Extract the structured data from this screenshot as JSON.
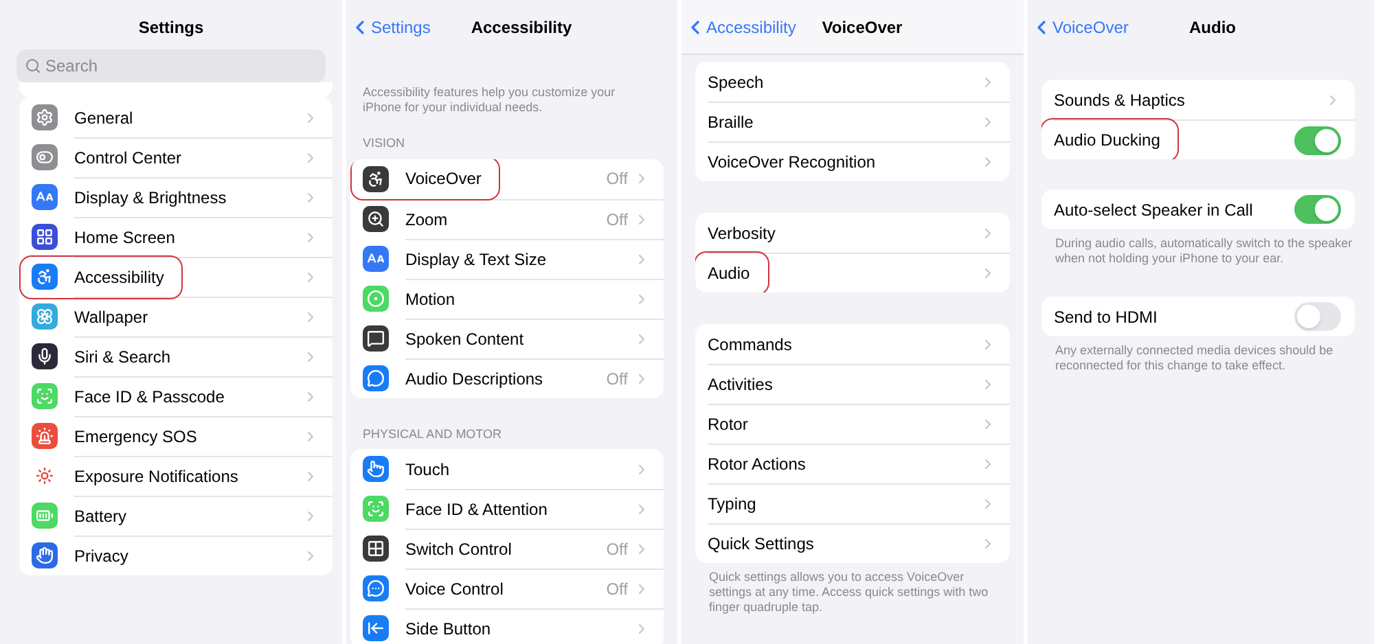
{
  "panels": [
    {
      "title": "Settings",
      "search": {
        "placeholder": "Search"
      },
      "groups": [
        {
          "items": [
            {
              "label": "General",
              "kind": "link",
              "color": "#8e8e93",
              "circled": false
            },
            {
              "label": "Control Center",
              "kind": "link",
              "color": "#8e8e93",
              "circled": false
            },
            {
              "label": "Display & Brightness",
              "kind": "link",
              "color": "#3478f6",
              "circled": false
            },
            {
              "label": "Home Screen",
              "kind": "link",
              "color": "#3a4fd6",
              "circled": false
            },
            {
              "label": "Accessibility",
              "kind": "link",
              "color": "#1a7cf5",
              "circled": true
            },
            {
              "label": "Wallpaper",
              "kind": "link",
              "color": "#35aadc",
              "circled": false
            },
            {
              "label": "Siri & Search",
              "kind": "link",
              "color": "#2a2a3a",
              "circled": false
            },
            {
              "label": "Face ID & Passcode",
              "kind": "link",
              "color": "#4cd964",
              "circled": false
            },
            {
              "label": "Emergency SOS",
              "kind": "link",
              "color": "#ea4e3d",
              "circled": false
            },
            {
              "label": "Exposure Notifications",
              "kind": "link",
              "color": "#ffffff",
              "circled": false
            },
            {
              "label": "Battery",
              "kind": "link",
              "color": "#4cd964",
              "circled": false
            },
            {
              "label": "Privacy",
              "kind": "link",
              "color": "#2c6ae6",
              "circled": false
            }
          ]
        }
      ]
    },
    {
      "back": "Settings",
      "title": "Accessibility",
      "intro": "Accessibility features help you customize your iPhone for your individual needs.",
      "groups": [
        {
          "header": "VISION",
          "items": [
            {
              "label": "VoiceOver",
              "kind": "link",
              "value": "Off",
              "color": "#3a3a3c",
              "circled": true
            },
            {
              "label": "Zoom",
              "kind": "link",
              "value": "Off",
              "color": "#3a3a3c",
              "circled": false
            },
            {
              "label": "Display & Text Size",
              "kind": "link",
              "color": "#3478f6",
              "circled": false
            },
            {
              "label": "Motion",
              "kind": "link",
              "color": "#4cd964",
              "circled": false
            },
            {
              "label": "Spoken Content",
              "kind": "link",
              "color": "#3a3a3c",
              "circled": false
            },
            {
              "label": "Audio Descriptions",
              "kind": "link",
              "value": "Off",
              "color": "#1a7cf5",
              "circled": false
            }
          ]
        },
        {
          "header": "PHYSICAL AND MOTOR",
          "items": [
            {
              "label": "Touch",
              "kind": "link",
              "color": "#1a7cf5",
              "circled": false
            },
            {
              "label": "Face ID & Attention",
              "kind": "link",
              "color": "#4cd964",
              "circled": false
            },
            {
              "label": "Switch Control",
              "kind": "link",
              "value": "Off",
              "color": "#3a3a3c",
              "circled": false
            },
            {
              "label": "Voice Control",
              "kind": "link",
              "value": "Off",
              "color": "#1a7cf5",
              "circled": false
            },
            {
              "label": "Side Button",
              "kind": "link",
              "color": "#1a7cf5",
              "circled": false
            }
          ]
        }
      ]
    },
    {
      "back": "Accessibility",
      "title": "VoiceOver",
      "groups": [
        {
          "items": [
            {
              "label": "Speech",
              "kind": "link",
              "circled": false
            },
            {
              "label": "Braille",
              "kind": "link",
              "circled": false
            },
            {
              "label": "VoiceOver Recognition",
              "kind": "link",
              "circled": false
            }
          ]
        },
        {
          "items": [
            {
              "label": "Verbosity",
              "kind": "link",
              "circled": false
            },
            {
              "label": "Audio",
              "kind": "link",
              "circled": true
            }
          ]
        },
        {
          "items": [
            {
              "label": "Commands",
              "kind": "link",
              "circled": false
            },
            {
              "label": "Activities",
              "kind": "link",
              "circled": false
            },
            {
              "label": "Rotor",
              "kind": "link",
              "circled": false
            },
            {
              "label": "Rotor Actions",
              "kind": "link",
              "circled": false
            },
            {
              "label": "Typing",
              "kind": "link",
              "circled": false
            },
            {
              "label": "Quick Settings",
              "kind": "link",
              "circled": false
            }
          ],
          "footer": "Quick settings allows you to access VoiceOver settings at any time. Access quick settings with two finger quadruple tap."
        }
      ]
    },
    {
      "back": "VoiceOver",
      "title": "Audio",
      "groups": [
        {
          "items": [
            {
              "label": "Sounds & Haptics",
              "kind": "link",
              "circled": false
            },
            {
              "label": "Audio Ducking",
              "kind": "toggle",
              "on": true,
              "circled": true
            }
          ]
        },
        {
          "items": [
            {
              "label": "Auto-select Speaker in Call",
              "kind": "toggle",
              "on": true,
              "circled": false
            }
          ],
          "footer": "During audio calls, automatically switch to the speaker when not holding your iPhone to your ear."
        },
        {
          "items": [
            {
              "label": "Send to HDMI",
              "kind": "toggle",
              "on": false,
              "circled": false
            }
          ],
          "footer": "Any externally connected media devices should be reconnected for this change to take effect."
        }
      ]
    }
  ]
}
